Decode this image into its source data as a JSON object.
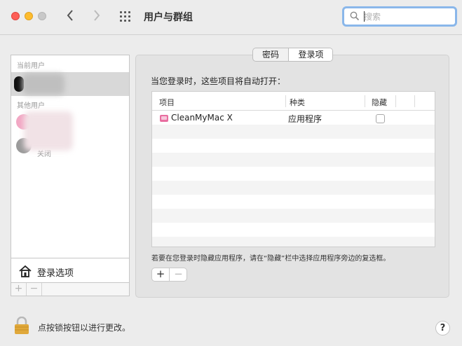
{
  "window": {
    "title": "用户与群组",
    "back_icon": "chevron-left-icon",
    "forward_icon": "chevron-right-icon",
    "grid_icon": "grid-icon"
  },
  "search": {
    "placeholder": "搜索",
    "value": ""
  },
  "sidebar": {
    "current_header": "当前用户",
    "other_header": "其他用户",
    "guest_status": "关闭",
    "login_options_label": "登录选项",
    "add_symbol": "+",
    "remove_symbol": "−"
  },
  "tabs": {
    "password": "密码",
    "login_items": "登录项",
    "selected": "登录项"
  },
  "login_items": {
    "intro": "当您登录时，这些项目将自动打开：",
    "columns": [
      "项目",
      "种类",
      "隐藏"
    ],
    "rows": [
      {
        "name": "CleanMyMac X",
        "kind": "应用程序",
        "hidden": false,
        "icon": "cleanmymac-icon"
      }
    ],
    "note": "若要在您登录时隐藏应用程序，请在“隐藏”栏中选择应用程序旁边的复选框。",
    "add_symbol": "+",
    "remove_symbol": "−"
  },
  "footer": {
    "lock_text": "点按锁按钮以进行更改。",
    "help_symbol": "?"
  },
  "colors": {
    "search_focus": "#8ab7ea",
    "selection": "#d8d8d8",
    "lock": "#e0a83a",
    "app_icon": "#e86ea0"
  }
}
